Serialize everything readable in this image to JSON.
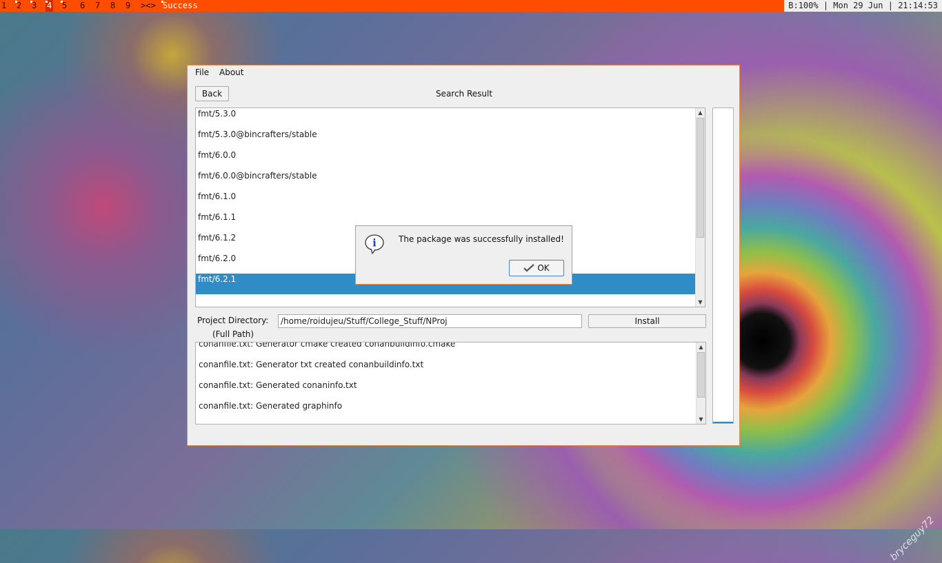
{
  "topbar": {
    "workspaces": [
      "1",
      "2",
      "3",
      "4",
      "5",
      "6",
      "7",
      "8",
      "9"
    ],
    "active_workspace": "4",
    "layout_symbol": "><>",
    "status_left": "Success",
    "status_right": "B:100% | Mon 29 Jun | 21:14:53"
  },
  "window": {
    "menu": {
      "file": "File",
      "about": "About"
    },
    "back_label": "Back",
    "title": "Search Result",
    "results": [
      "fmt/5.3.0",
      "fmt/5.3.0@bincrafters/stable",
      "fmt/6.0.0",
      "fmt/6.0.0@bincrafters/stable",
      "fmt/6.1.0",
      "fmt/6.1.1",
      "fmt/6.1.2",
      "fmt/6.2.0",
      "fmt/6.2.1"
    ],
    "selected_result": "fmt/6.2.1",
    "project_dir_label": "Project Directory:",
    "full_path_label": "(Full Path)",
    "project_dir_value": "/home/roidujeu/Stuff/College_Stuff/NProj",
    "install_label": "Install",
    "log_lines": [
      "conanfile.txt: Generator cmake created conanbuildinfo.cmake",
      "conanfile.txt: Generator txt created conanbuildinfo.txt",
      "conanfile.txt: Generated conaninfo.txt",
      "conanfile.txt: Generated graphinfo"
    ]
  },
  "dialog": {
    "icon": "info-icon",
    "message": "The package was successfully installed!",
    "ok_label": "OK"
  },
  "wallpaper": {
    "signature": "bryceguy72"
  }
}
